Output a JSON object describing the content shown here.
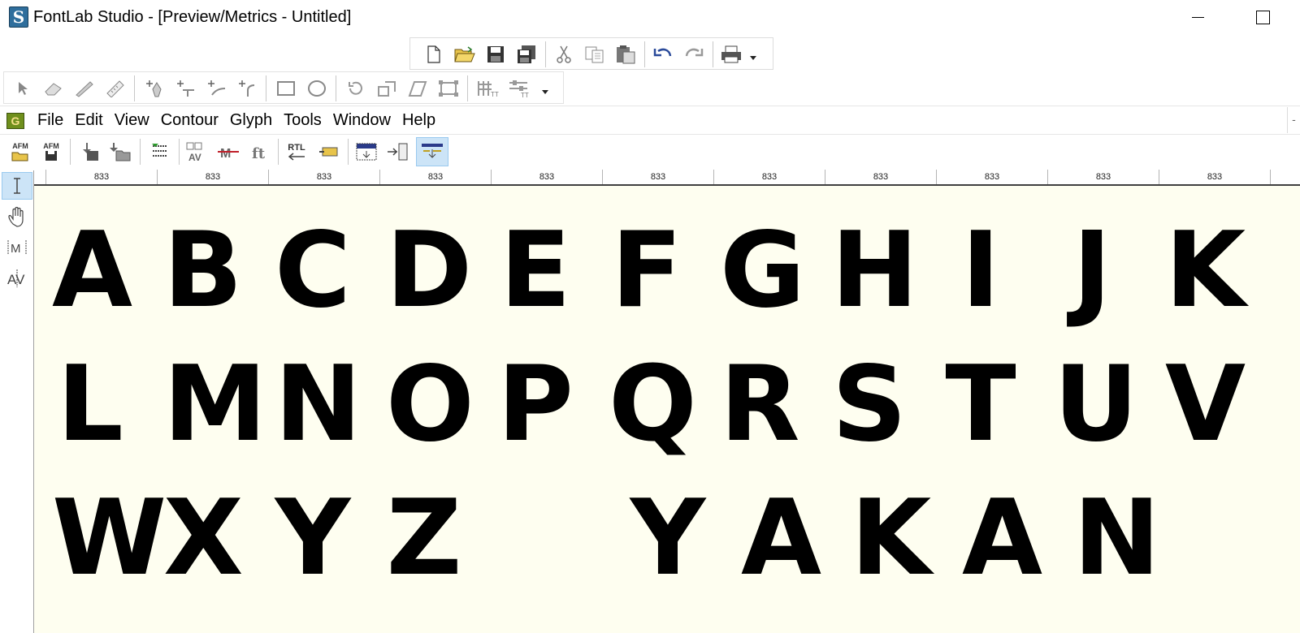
{
  "window": {
    "app_icon_letter": "S",
    "title": "FontLab Studio - [Preview/Metrics - Untitled]"
  },
  "menu": {
    "logo_letter": "G",
    "items": [
      "File",
      "Edit",
      "View",
      "Contour",
      "Glyph",
      "Tools",
      "Window",
      "Help"
    ],
    "right_stub": "-"
  },
  "toolbar_metrics": {
    "afm_open_label": "AFM",
    "afm_save_label": "AFM",
    "rtl_label": "RTL"
  },
  "ruler": {
    "widths": [
      "833",
      "833",
      "833",
      "833",
      "833",
      "833",
      "833",
      "833",
      "833",
      "833",
      "833"
    ]
  },
  "preview": {
    "rows": [
      [
        "A",
        "B",
        "C",
        "D",
        "E",
        "F",
        "G",
        "H",
        "I",
        "J",
        "K"
      ],
      [
        "L",
        "M",
        "N",
        "O",
        "P",
        "Q",
        "R",
        "S",
        "T",
        "U",
        "V"
      ],
      [
        "W",
        "X",
        "Y",
        "Z",
        "",
        "Y",
        "A",
        "K",
        "A",
        "N",
        ""
      ]
    ]
  },
  "colors": {
    "canvas_bg": "#fefef0",
    "active_tool_bg": "#cce4f7",
    "glyph_fill": "#000000"
  }
}
